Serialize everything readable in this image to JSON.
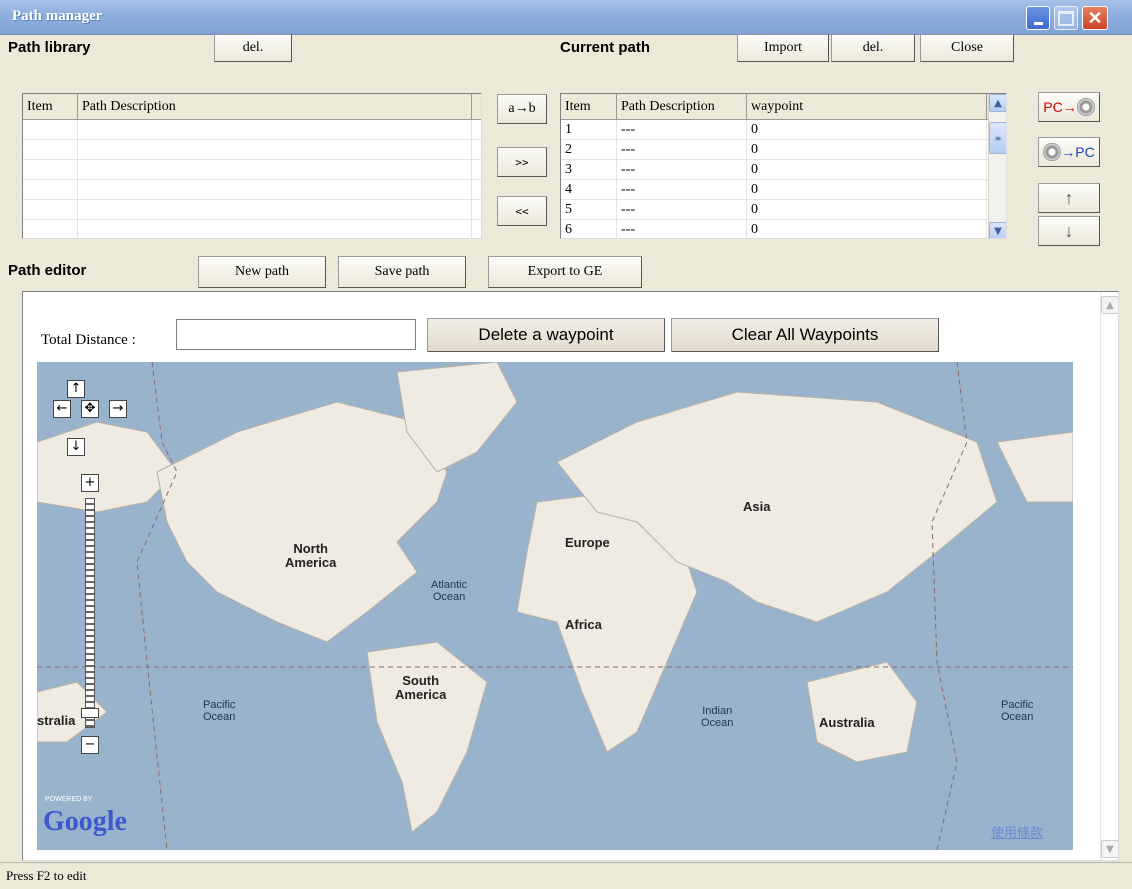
{
  "window": {
    "title": "Path manager"
  },
  "library": {
    "label": "Path library",
    "del_label": "del.",
    "columns": [
      "Item",
      "Path Description"
    ]
  },
  "transfer": {
    "ab_label": "a→b",
    "add_label": ">>",
    "remove_label": "<<"
  },
  "current": {
    "label": "Current path",
    "import_label": "Import",
    "del_label": "del.",
    "close_label": "Close",
    "columns": [
      "Item",
      "Path Description",
      "waypoint"
    ],
    "rows": [
      {
        "item": "1",
        "desc": "---",
        "waypoint": "0"
      },
      {
        "item": "2",
        "desc": "---",
        "waypoint": "0"
      },
      {
        "item": "3",
        "desc": "---",
        "waypoint": "0"
      },
      {
        "item": "4",
        "desc": "---",
        "waypoint": "0"
      },
      {
        "item": "5",
        "desc": "---",
        "waypoint": "0"
      },
      {
        "item": "6",
        "desc": "---",
        "waypoint": "0"
      }
    ]
  },
  "side": {
    "pc_to_device": "PC→",
    "device_to_pc": "→PC",
    "up": "↑",
    "down": "↓"
  },
  "editor": {
    "label": "Path editor",
    "new_label": "New path",
    "save_label": "Save path",
    "export_label": "Export to GE"
  },
  "mapview": {
    "total_label": "Total Distance :",
    "total_value": "",
    "delete_label": "Delete a waypoint",
    "clear_label": "Clear All Waypoints",
    "labels": {
      "north_america": "North\nAmerica",
      "south_america": "South\nAmerica",
      "europe": "Europe",
      "africa": "Africa",
      "asia": "Asia",
      "australia": "Australia",
      "australia_left": "stralia"
    },
    "oceans": {
      "atlantic": "Atlantic\nOcean",
      "pacific_left": "Pacific\nOcean",
      "indian": "Indian\nOcean",
      "pacific_right": "Pacific\nOcean"
    },
    "powered_by": "POWERED BY",
    "google": "Google",
    "terms": "使用條款"
  },
  "status": {
    "text": "Press F2 to edit"
  }
}
